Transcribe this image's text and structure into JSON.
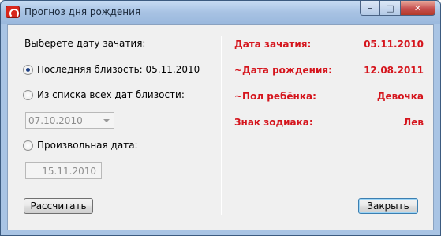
{
  "window": {
    "title": "Прогноз дня рождения",
    "minimize_glyph": "–",
    "maximize_glyph": "□",
    "close_glyph": "✕"
  },
  "left": {
    "prompt": "Выберете дату зачатия:",
    "option_last": "Последняя близость: 05.11.2010",
    "option_list": "Из списка всех дат близости:",
    "list_selected": "07.10.2010",
    "option_custom": "Произвольная дата:",
    "custom_date": "15.11.2010",
    "calculate_label": "Рассчитать"
  },
  "right": {
    "rows": [
      {
        "label": "Дата зачатия:",
        "value": "05.11.2010"
      },
      {
        "label": "~Дата рождения:",
        "value": "12.08.2011"
      },
      {
        "label": "~Пол ребёнка:",
        "value": "Девочка"
      },
      {
        "label": "Знак зодиака:",
        "value": "Лев"
      }
    ],
    "close_label": "Закрыть"
  },
  "colors": {
    "accent_red": "#d5151d"
  }
}
